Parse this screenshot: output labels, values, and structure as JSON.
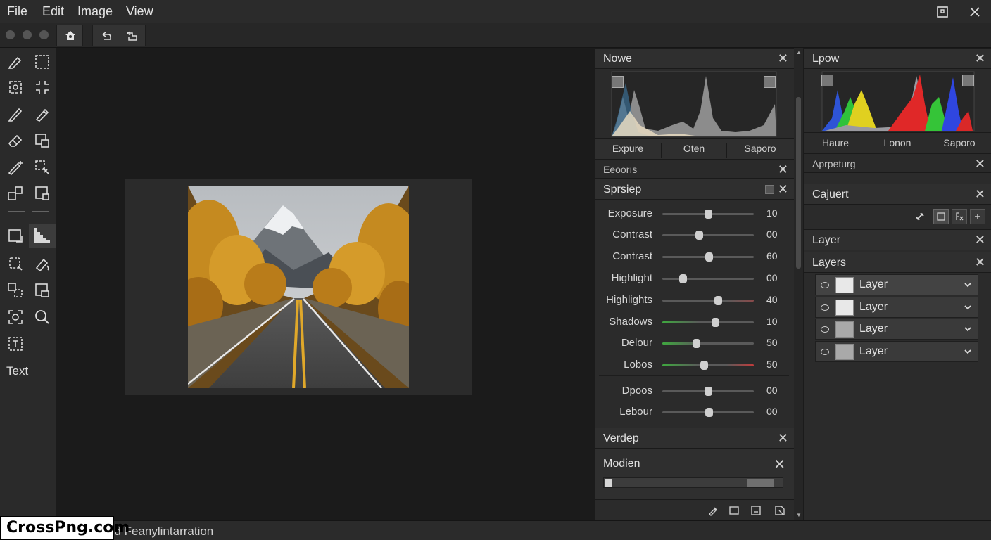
{
  "menu": {
    "items": [
      {
        "label": "File"
      },
      {
        "label": "Edit"
      },
      {
        "label": "Image"
      },
      {
        "label": "View"
      }
    ]
  },
  "toolbox": {
    "text_tool_label": "Text"
  },
  "status": {
    "text": "nd Feanylintarration"
  },
  "watermark": {
    "text": "CrossPng.com"
  },
  "histogram_panel_left": {
    "title": "Nowe",
    "tabs": [
      {
        "label": "Expure"
      },
      {
        "label": "Oten"
      },
      {
        "label": "Saporo"
      }
    ],
    "sub_header": "Eeoorıs"
  },
  "adjust_panel": {
    "title": "Sprsiep",
    "sliders": [
      {
        "label": "Exposure",
        "value_text": "10",
        "position": 0.5
      },
      {
        "label": "Contrast",
        "value_text": "00",
        "position": 0.4
      },
      {
        "label": "Contrast",
        "value_text": "60",
        "position": 0.51
      },
      {
        "label": "Highlight",
        "value_text": "00",
        "position": 0.22
      },
      {
        "label": "Highlights",
        "value_text": "40",
        "position": 0.61,
        "track": "redtip"
      },
      {
        "label": "Shadows",
        "value_text": "10",
        "position": 0.58,
        "track": "green"
      },
      {
        "label": "Delour",
        "value_text": "50",
        "position": 0.37,
        "track": "green"
      },
      {
        "label": "Lobos",
        "value_text": "50",
        "position": 0.45,
        "track": "greenred"
      },
      {
        "label": "Dpoos",
        "value_text": "00",
        "position": 0.5
      },
      {
        "label": "Lebour",
        "value_text": "00",
        "position": 0.51
      }
    ]
  },
  "verdep_panel": {
    "title": "Verdep"
  },
  "modien_panel": {
    "title": "Modien"
  },
  "histogram_panel_right": {
    "title": "Lpow",
    "tabs": [
      {
        "label": "Haure"
      },
      {
        "label": "Lonon"
      },
      {
        "label": "Saporo"
      }
    ]
  },
  "right_panels": {
    "aprpeturg_title": "Aprpeturg",
    "cajuert_title": "Cajuert",
    "layer_title": "Layer",
    "layers_title": "Layers"
  },
  "layers": [
    {
      "name": "Layer",
      "thumb_color": "#e8e8e8"
    },
    {
      "name": "Layer",
      "thumb_color": "#e8e8e8"
    },
    {
      "name": "Layer",
      "thumb_color": "#a9a9a9"
    },
    {
      "name": "Layer",
      "thumb_color": "#a9a9a9"
    }
  ],
  "colors": {
    "background": "#1b1b1b",
    "panel": "#2b2b2b",
    "header": "#2f2f2f",
    "accent_orange": "#c98a1e"
  }
}
